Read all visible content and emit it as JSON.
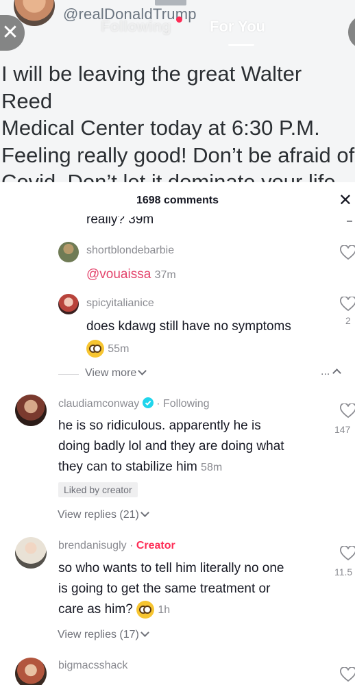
{
  "video": {
    "handle": "@realDonaldTrump",
    "tweet_lines": [
      "I will be leaving the great Walter Reed",
      "Medical Center today at 6:30 P.M.",
      "Feeling really good! Don’t be afraid of",
      "Covid. Don’t let it dominate your life."
    ]
  },
  "top_nav": {
    "tabs": [
      {
        "label": "Following",
        "active": false
      },
      {
        "label": "For You",
        "active": true
      }
    ],
    "close_glyph": "✕"
  },
  "comments_sheet": {
    "title": "1698 comments",
    "close_glyph": "✕",
    "partial_top": {
      "text": "really? 39m"
    },
    "replies": [
      {
        "username": "shortblondebarbie",
        "mention": "@vouaissa",
        "time": "37m",
        "likes": ""
      },
      {
        "username": "spicyitalianice",
        "text": "does kdawg still have no symptoms",
        "time": "55m",
        "likes": "2"
      }
    ],
    "view_more_label": "View more",
    "collapse_label": "...",
    "comments": [
      {
        "username": "claudiamconway",
        "verified": true,
        "relation": "Following",
        "text_lines": [
          "he is so ridiculous. apparently he is",
          "doing badly lol and they are doing what",
          "they can to stabilize him"
        ],
        "time": "58m",
        "likes": "147",
        "badge": "Liked by creator",
        "view_replies": "View replies (21)"
      },
      {
        "username": "brendanisugly",
        "relation": "Creator",
        "text_lines": [
          "so who wants to tell him literally no one",
          "is going to get the same treatment or",
          "care as him?"
        ],
        "time": "1h",
        "likes": "11.5",
        "view_replies": "View replies (17)"
      },
      {
        "username": "bigmacsshack"
      }
    ]
  },
  "colors": {
    "accent": "#fe2c55",
    "mention": "#e3436b",
    "verified": "#20d5ec",
    "muted": "#8a8b91"
  }
}
